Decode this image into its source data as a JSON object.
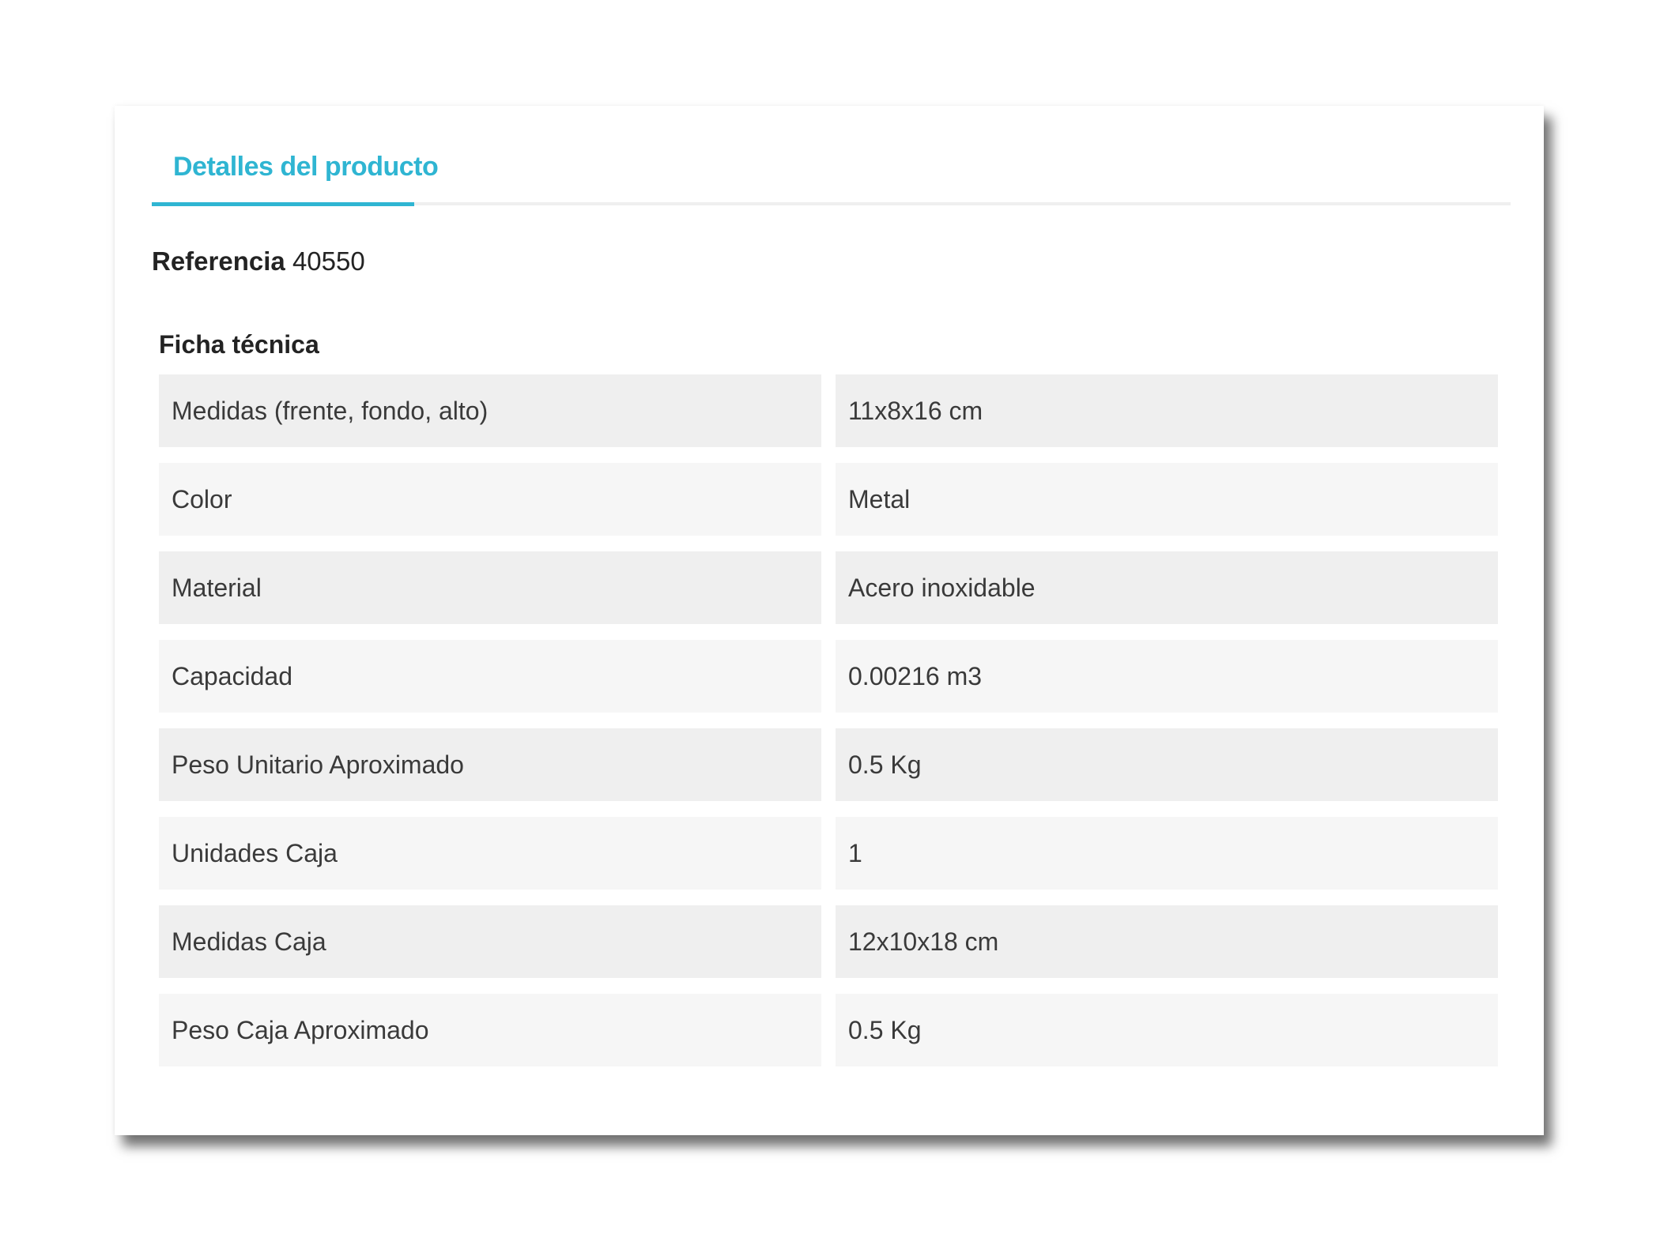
{
  "tabs": [
    {
      "label": "Detalles del producto",
      "active": true
    }
  ],
  "reference": {
    "label": "Referencia",
    "value": "40550"
  },
  "data_sheet": {
    "title": "Ficha técnica",
    "rows": [
      {
        "name": "Medidas (frente, fondo, alto)",
        "value": "11x8x16 cm"
      },
      {
        "name": "Color",
        "value": "Metal"
      },
      {
        "name": "Material",
        "value": "Acero inoxidable"
      },
      {
        "name": "Capacidad",
        "value": "0.00216 m3"
      },
      {
        "name": "Peso Unitario Aproximado",
        "value": "0.5 Kg"
      },
      {
        "name": "Unidades Caja",
        "value": "1"
      },
      {
        "name": "Medidas Caja",
        "value": "12x10x18 cm"
      },
      {
        "name": "Peso Caja Aproximado",
        "value": "0.5 Kg"
      }
    ]
  },
  "colors": {
    "accent": "#2fb5d2",
    "row_dark": "#efefef",
    "row_light": "#f6f6f6"
  }
}
